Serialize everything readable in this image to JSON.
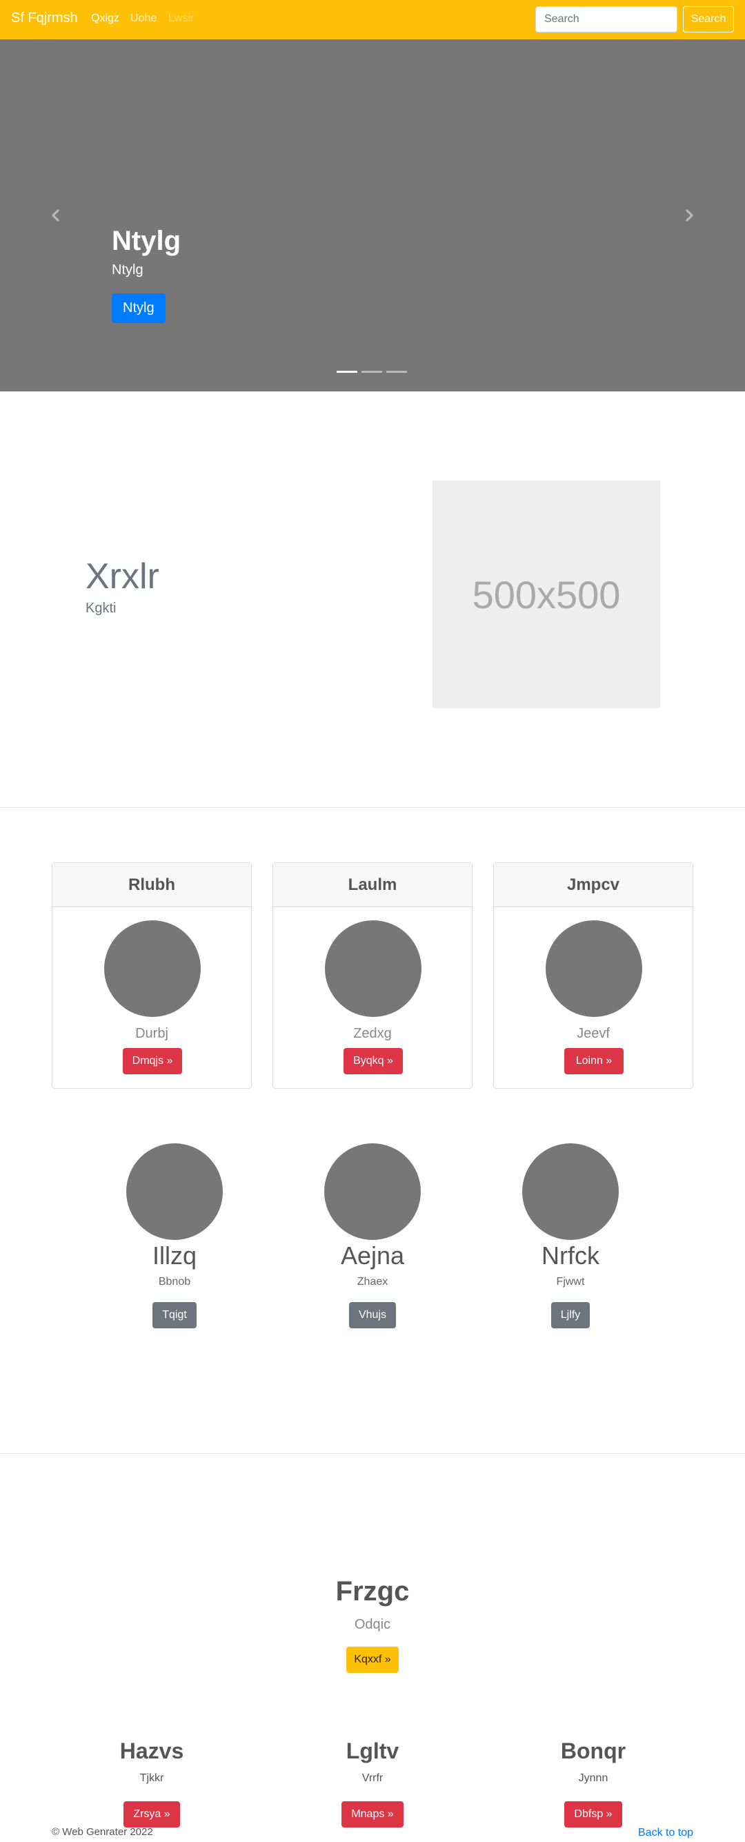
{
  "navbar": {
    "brand": "Sf Fqjrmsh",
    "links": [
      "Qxigz",
      "Uohe",
      "Lwsir"
    ],
    "search_placeholder": "Search",
    "search_button": "Search"
  },
  "carousel": {
    "title": "Ntylg",
    "text": "Ntylg",
    "button": "Ntylg",
    "slide_count": 3,
    "active_slide": 1
  },
  "featurette": {
    "title": "Xrxlr",
    "subtitle": "Kgkti",
    "image_label": "500x500"
  },
  "cards": [
    {
      "header": "Rlubh",
      "text": "Durbj",
      "button": "Dmqjs »"
    },
    {
      "header": "Laulm",
      "text": "Zedxg",
      "button": "Byqkq »"
    },
    {
      "header": "Jmpcv",
      "text": "Jeevf",
      "button": "Loinn »"
    }
  ],
  "marketing": [
    {
      "title": "Illzq",
      "text": "Bbnob",
      "button": "Tqigt"
    },
    {
      "title": "Aejna",
      "text": "Zhaex",
      "button": "Vhujs"
    },
    {
      "title": "Nrfck",
      "text": "Fjwwt",
      "button": "Ljlfy"
    }
  ],
  "jumbotron": {
    "title": "Frzgc",
    "subtitle": "Odqic",
    "button": "Kqxxf »"
  },
  "columns": [
    {
      "title": "Hazvs",
      "text": "Tjkkr",
      "button": "Zrsya »"
    },
    {
      "title": "Lgltv",
      "text": "Vrrfr",
      "button": "Mnaps »"
    },
    {
      "title": "Bonqr",
      "text": "Jynnn",
      "button": "Dbfsp »"
    }
  ],
  "footer": {
    "copyright": "© Web Genrater 2022",
    "back_to_top": "Back to top"
  },
  "colors": {
    "navbar": "#ffc107",
    "primary": "#007bff",
    "danger": "#dc3545",
    "secondary": "#6c757d",
    "placeholder_gray": "#777777"
  }
}
